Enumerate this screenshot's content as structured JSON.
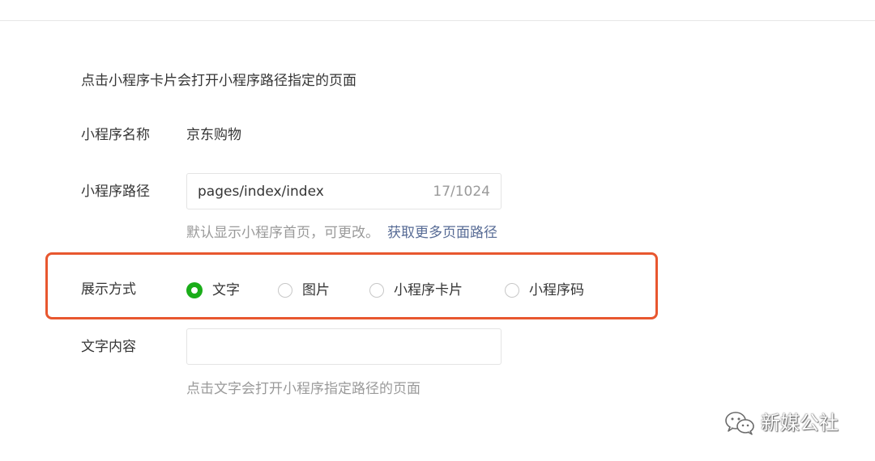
{
  "intro_text": "点击小程序卡片会打开小程序路径指定的页面",
  "mini_program_name": {
    "label": "小程序名称",
    "value": "京东购物"
  },
  "mini_program_path": {
    "label": "小程序路径",
    "value": "pages/index/index",
    "counter": "17/1024",
    "hint": "默认显示小程序首页，可更改。",
    "hint_link": "获取更多页面路径"
  },
  "display_mode": {
    "label": "展示方式",
    "options": [
      {
        "label": "文字",
        "selected": true
      },
      {
        "label": "图片",
        "selected": false
      },
      {
        "label": "小程序卡片",
        "selected": false
      },
      {
        "label": "小程序码",
        "selected": false
      }
    ],
    "highlight_color": "#e8572f"
  },
  "text_content": {
    "label": "文字内容",
    "value": "",
    "hint": "点击文字会打开小程序指定路径的页面"
  },
  "watermark": {
    "icon": "wechat-icon",
    "text": "新媒公社"
  },
  "colors": {
    "accent_green": "#1aad19",
    "link_blue": "#576b95"
  }
}
